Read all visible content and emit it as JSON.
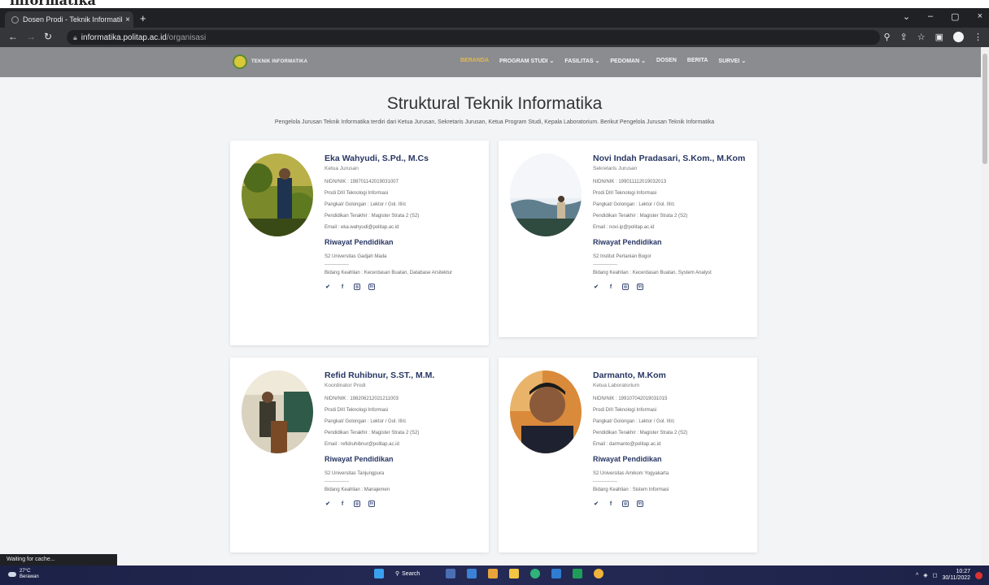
{
  "window": {
    "top_clipped_text": "informatika",
    "tab_title": "Dosen Prodi - Teknik Informatika",
    "new_tab": "+",
    "controls": [
      "⌄",
      "–",
      "▢",
      "×"
    ]
  },
  "address": {
    "host": "informatika.politap.ac.id",
    "path": "/organisasi"
  },
  "site": {
    "logo_text": "TEKNIK INFORMATIKA",
    "nav": [
      "BERANDA",
      "PROGRAM STUDI ⌄",
      "FASILITAS ⌄",
      "PEDOMAN ⌄",
      "DOSEN",
      "BERITA",
      "SURVEI ⌄"
    ]
  },
  "page": {
    "title": "Struktural Teknik Informatika",
    "subtitle": "Pengelola Jurusan Teknik Informatika terdiri dari Ketua Jurusan, Sekretaris Jurusan, Ketua Program Studi, Kepala Laboratorium. Berikut Pengelola Jurusan Teknik Informatika"
  },
  "edu_heading": "Riwayat Pendidikan",
  "staff": [
    {
      "name": "Eka Wahyudi, S.Pd., M.Cs",
      "role": "Ketua Jurusan",
      "nidn": "NIDN/NIK : 198701142019031007",
      "prodi": "Prodi DIII Teknologi Informasi",
      "rank": "Pangkat/ Golongan : Lektor / Gol. III/c",
      "education_level": "Pendidikan Terakhir : Magister Strata 2 (S2)",
      "email": "Email : eka.wahyudi@politap.ac.id",
      "degree": "S2 Universitas Gadjah Mada",
      "expertise": "Bidang Keahlian : Kecerdasan Buatan, Database Arsitektur"
    },
    {
      "name": "Novi Indah Pradasari, S.Kom., M.Kom",
      "role": "Sekretaris Jurusan",
      "nidn": "NIDN/NIK : 199011112019032013",
      "prodi": "Prodi DIII Teknologi Informasi",
      "rank": "Pangkat/ Golongan : Lektor / Gol. III/c",
      "education_level": "Pendidikan Terakhir : Magister Strata 2 (S2)",
      "email": "Email : novi.ip@politap.ac.id",
      "degree": "S2 Institut Pertanian Bogor",
      "expertise": "Bidang Keahlian : Kecerdasan Buatan, System Analyst"
    },
    {
      "name": "Refid Ruhibnur, S.ST., M.M.",
      "role": "Koordinator Prodi",
      "nidn": "NIDN/NIK : 198206212021211003",
      "prodi": "Prodi DIII Teknologi Informasi",
      "rank": "Pangkat/ Golongan : Lektor / Gol. III/c",
      "education_level": "Pendidikan Terakhir : Magister Strata 2 (S2)",
      "email": "Email : refidruhibnur@politap.ac.id",
      "degree": "S2 Universitas Tanjungpura",
      "expertise": "Bidang Keahlian : Manajemen"
    },
    {
      "name": "Darmanto, M.Kom",
      "role": "Ketua Laboratorium",
      "nidn": "NIDN/NIK : 199107042019031015",
      "prodi": "Prodi DIII Teknologi Informasi",
      "rank": "Pangkat/ Golongan : Lektor / Gol. III/c",
      "education_level": "Pendidikan Terakhir : Magister Strata 2 (S2)",
      "email": "Email : darmanto@politap.ac.id",
      "degree": "S2 Universitas Amikom Yogyakarta",
      "expertise": "Bidang Keahlian : Sistem Informasi"
    }
  ],
  "status_text": "Waiting for cache...",
  "taskbar": {
    "temp": "27°C",
    "weather": "Berawan",
    "search": "Search",
    "time": "10:27",
    "date": "30/11/2022"
  },
  "colors": {
    "nav_bg": "#8b8c90",
    "heading_blue": "#273663",
    "active_nav": "#e3b84a"
  }
}
